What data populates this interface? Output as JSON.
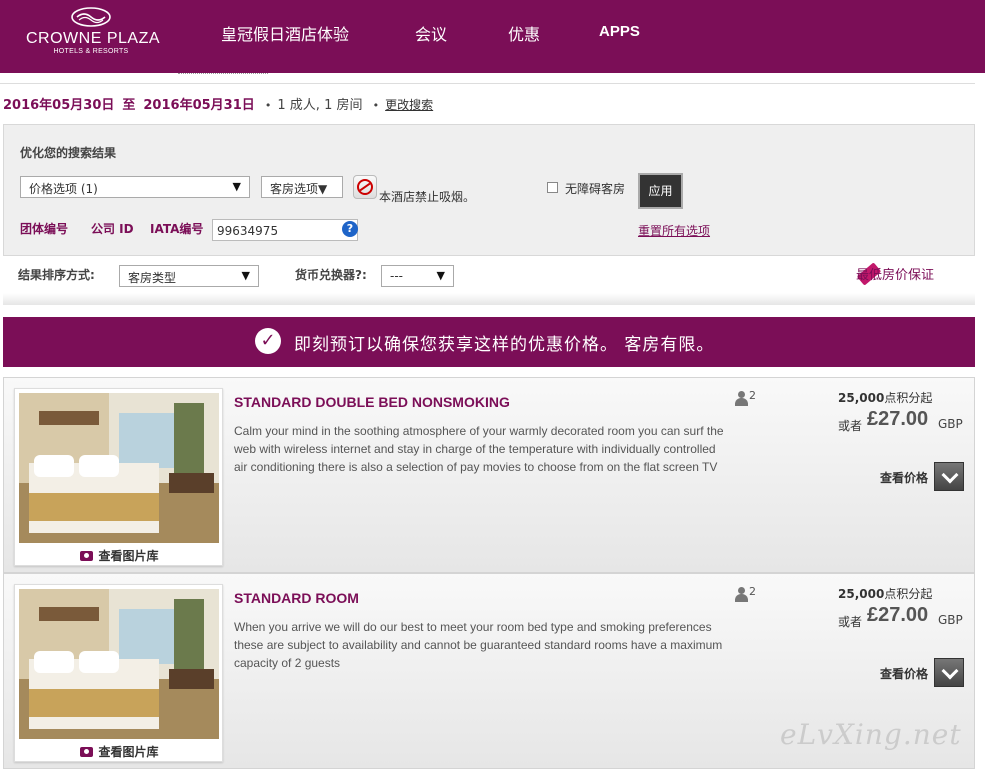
{
  "header": {
    "logo_name": "CROWNE PLAZA",
    "logo_sub": "HOTELS & RESORTS",
    "nav": [
      "皇冠假日酒店体验",
      "会议",
      "优惠",
      "APPS"
    ],
    "bg_color": "#7b0e57"
  },
  "search_summary": {
    "checkin": "2016年05月30日",
    "separator": "至",
    "checkout": "2016年05月31日",
    "guests": "1 成人, 1 房间",
    "change_link": "更改搜索"
  },
  "filter": {
    "title": "优化您的搜索结果",
    "price_option": "价格选项 (1)",
    "room_option": "客房选项",
    "nosmoke_text": "本酒店禁止吸烟。",
    "accessible_label": "无障碍客房",
    "accessible_checked": false,
    "apply_label": "应用",
    "group_code_label": "团体编号",
    "company_id_label": "公司 ID",
    "iata_label": "IATA编号",
    "iata_value": "99634975",
    "help_symbol": "?",
    "reset_link": "重置所有选项"
  },
  "sort": {
    "label": "结果排序方式:",
    "value": "客房类型",
    "currency_label": "货币兑换器?:",
    "currency_value": "---",
    "guarantee": "最低房价保证"
  },
  "banner": {
    "check_symbol": "✓",
    "text": "即刻预订以确保您获享这样的优惠价格。 客房有限。"
  },
  "rooms": [
    {
      "title": "STANDARD DOUBLE BED NONSMOKING",
      "description": "Calm your mind in the soothing atmosphere of your warmly decorated room you can surf the web with wireless internet and stay in charge of the temperature with individually controlled air conditioning there is also a selection of pay movies to choose from on the flat screen TV",
      "guests": "2",
      "points": "25,000",
      "points_suffix": "点积分起",
      "or_label": "或者",
      "price": "£27.00",
      "currency": "GBP",
      "view_price": "查看价格",
      "gallery": "查看图片库"
    },
    {
      "title": "STANDARD ROOM",
      "description": "When you arrive we will do our best to meet your room bed type and smoking preferences these are subject to availability and cannot be guaranteed standard rooms have a maximum capacity of 2 guests",
      "guests": "2",
      "points": "25,000",
      "points_suffix": "点积分起",
      "or_label": "或者",
      "price": "£27.00",
      "currency": "GBP",
      "view_price": "查看价格",
      "gallery": "查看图片库"
    }
  ],
  "watermark": "eLvXing.net"
}
